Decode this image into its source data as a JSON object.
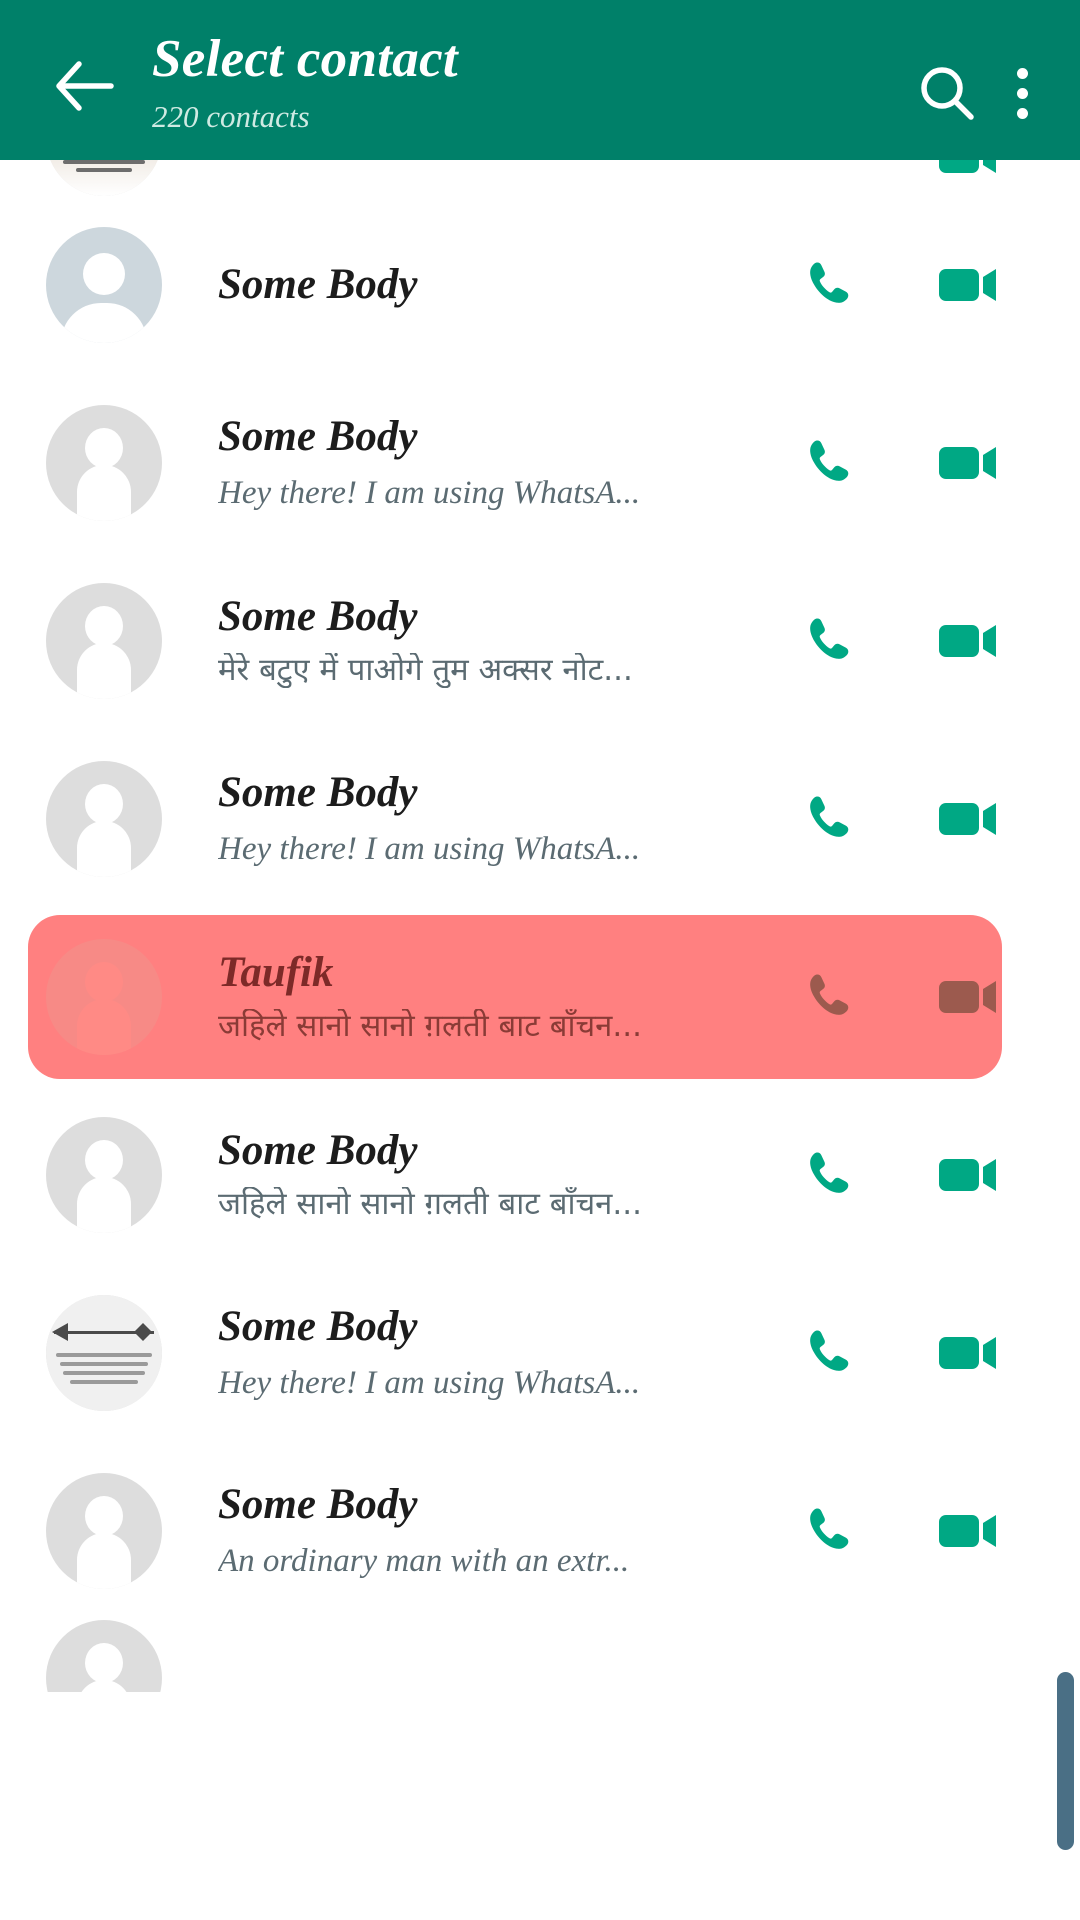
{
  "header": {
    "title": "Select contact",
    "subtitle": "220 contacts",
    "back_icon": "arrow-left-icon",
    "search_icon": "search-icon",
    "menu_icon": "overflow-menu-icon",
    "background_color": "#008069",
    "title_color": "#ffffff",
    "subtitle_color": "#cfeae3"
  },
  "theme": {
    "accent_green": "#00a884",
    "highlight_red": "#ff8080",
    "highlight_icon": "#9c5a4e",
    "avatar_grey": "#dddddd",
    "avatar_blue_grey": "#cdd7dd",
    "scrollbar_color": "#4a6f85",
    "page_background": "#ffffff"
  },
  "list": {
    "call_icon": "phone-icon",
    "video_icon": "video-camera-icon",
    "rows": [
      {
        "name": "",
        "status": "",
        "avatar": "photo-crowd",
        "selected": false,
        "clipped": "top"
      },
      {
        "name": "Some Body",
        "status": "",
        "avatar": "glyph-dome",
        "avatar_tint": "blue",
        "selected": false
      },
      {
        "name": "Some Body",
        "status": "Hey there! I am using WhatsA...",
        "avatar": "glyph-person",
        "selected": false
      },
      {
        "name": "Some Body",
        "status": "मेरे बटुए में पाओगे तुम अक्सर नोट...",
        "avatar": "glyph-person",
        "script": "devanagari",
        "selected": false
      },
      {
        "name": "Some Body",
        "status": "Hey there! I am using WhatsA...",
        "avatar": "glyph-person",
        "selected": false
      },
      {
        "name": "Taufik",
        "status": "जहिले सानो सानो ग़लती बाट बाँचन...",
        "avatar": "glyph-person",
        "avatar_tint": "red",
        "script": "devanagari",
        "selected": true
      },
      {
        "name": "Some Body",
        "status": "जहिले सानो सानो ग़लती बाट बाँचन...",
        "avatar": "glyph-person",
        "script": "devanagari",
        "selected": false
      },
      {
        "name": "Some Body",
        "status": "Hey there! I am using WhatsA...",
        "avatar": "photo-arrow",
        "selected": false
      },
      {
        "name": "Some Body",
        "status": "An ordinary man with an extr...",
        "avatar": "glyph-person",
        "selected": false
      },
      {
        "name": "",
        "status": "",
        "avatar": "glyph-person",
        "selected": false,
        "clipped": "bottom"
      }
    ]
  },
  "scrollbar": {
    "name": "vertical-scrollbar"
  }
}
